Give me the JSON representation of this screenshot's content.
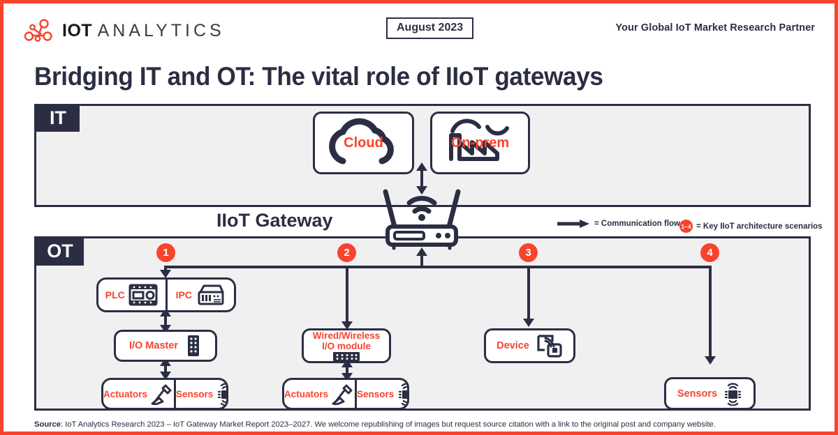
{
  "header": {
    "logo_text_bold": "IOT",
    "logo_text_thin": "ANALYTICS",
    "logo_icon": "network-nodes-icon",
    "date_badge": "August 2023",
    "tagline": "Your Global IoT Market Research Partner"
  },
  "title": "Bridging IT and OT: The vital role of IIoT gateways",
  "panels": {
    "it_label": "IT",
    "ot_label": "OT"
  },
  "it_layer": {
    "cloud": {
      "label": "Cloud",
      "icon": "cloud-icon"
    },
    "onprem": {
      "label": "On-prem",
      "icon": "factory-icon"
    }
  },
  "gateway": {
    "label": "IIoT Gateway",
    "icon": "router-gateway-icon"
  },
  "legend": {
    "flow_label": "= Communication flow",
    "flow_icon": "arrow-right-icon",
    "scenarios_badge": "1–4",
    "scenarios_label": "= Key IIoT architecture scenarios"
  },
  "markers": [
    "1",
    "2",
    "3",
    "4"
  ],
  "scenario1": {
    "controllers": [
      {
        "label": "PLC",
        "icon": "plc-module-icon"
      },
      {
        "label": "IPC",
        "icon": "industrial-pc-icon"
      }
    ],
    "io_master": {
      "label": "I/O Master",
      "icon": "io-module-icon"
    },
    "endpoints": [
      {
        "label": "Actuators",
        "icon": "robot-arm-icon"
      },
      {
        "label": "Sensors",
        "icon": "sensor-chip-icon"
      }
    ]
  },
  "scenario2": {
    "module": {
      "label_line1": "Wired/Wireless",
      "label_line2": "I/O module",
      "icon": "terminal-block-icon"
    },
    "endpoints": [
      {
        "label": "Actuators",
        "icon": "robot-arm-icon"
      },
      {
        "label": "Sensors",
        "icon": "sensor-chip-icon"
      }
    ]
  },
  "scenario3": {
    "device": {
      "label": "Device",
      "icon": "connected-device-icon"
    }
  },
  "scenario4": {
    "sensors": {
      "label": "Sensors",
      "icon": "sensor-chip-icon"
    }
  },
  "footer": {
    "source_label": "Source",
    "source_text": ": IoT Analytics Research 2023 – IoT Gateway Market Report 2023–2027. We welcome republishing of images but request source citation with a link to the original post and company website."
  },
  "colors": {
    "accent_red": "#F8432D",
    "navy": "#2B2E43",
    "panel_gray": "#F0F0F1"
  }
}
